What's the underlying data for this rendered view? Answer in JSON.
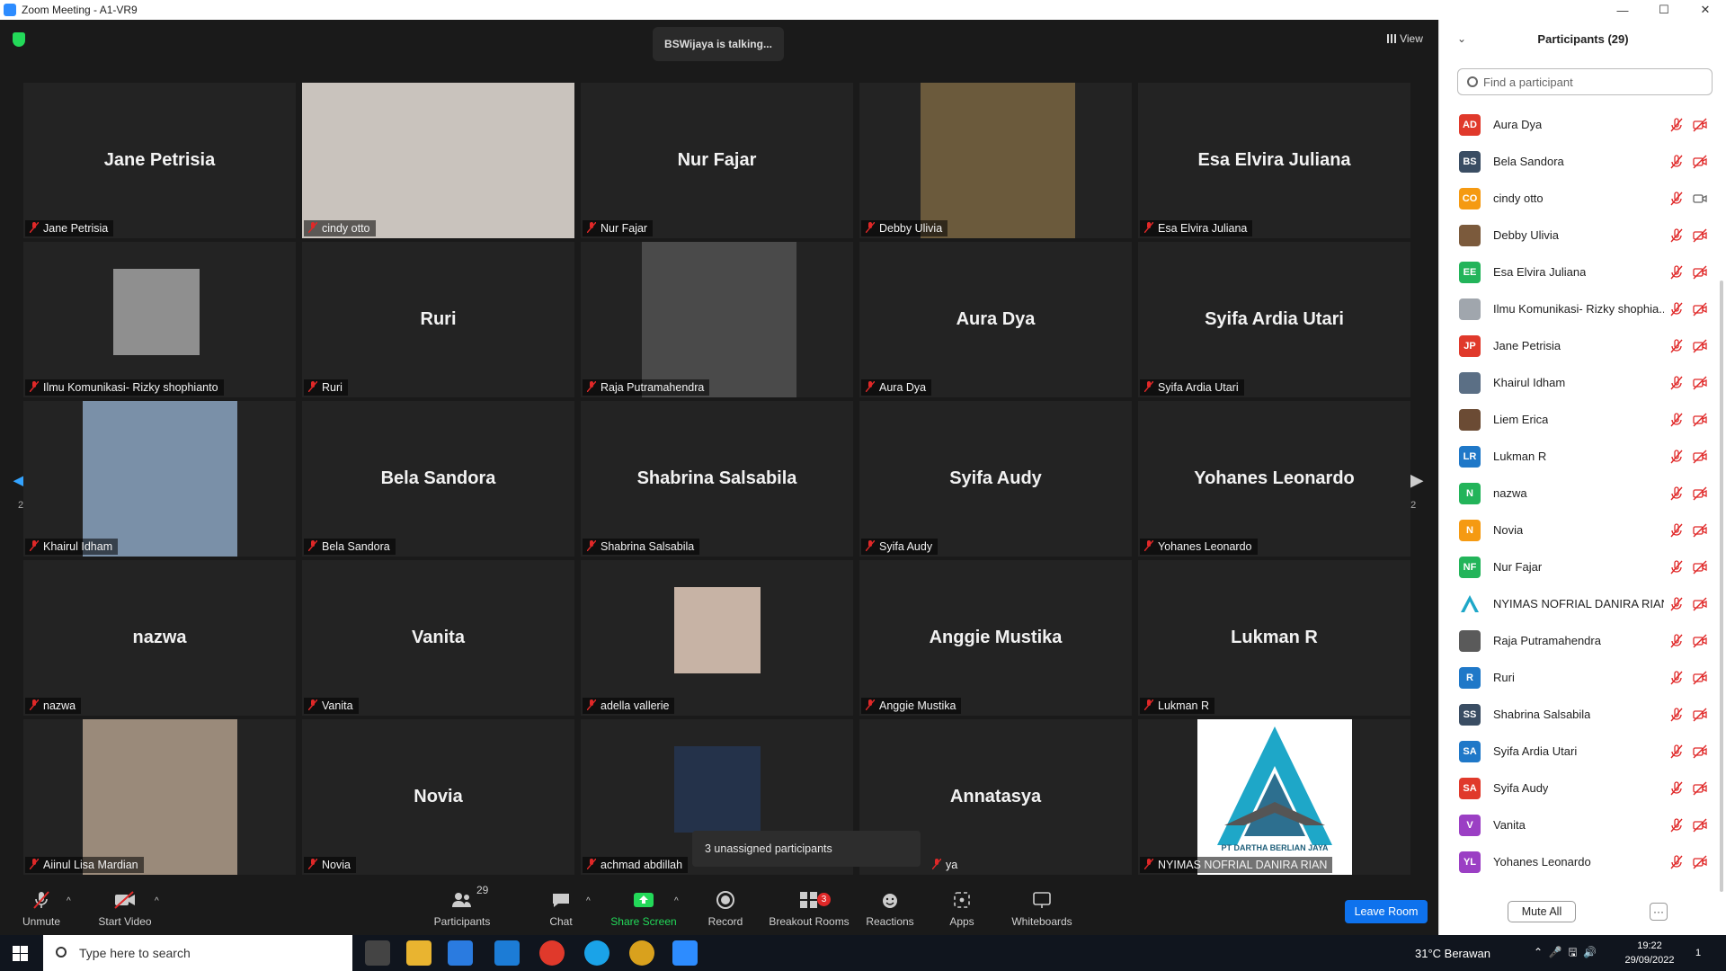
{
  "window": {
    "title": "Zoom Meeting - A1-VR9",
    "ctrl_min": "—",
    "ctrl_max": "☐",
    "ctrl_close": "✕"
  },
  "meeting": {
    "talking": "BSWijaya is talking...",
    "view_label": "View",
    "page_left": "2/2",
    "page_right": "2/2",
    "unassigned": "3 unassigned participants"
  },
  "tiles": [
    {
      "big": "Jane Petrisia",
      "label": "Jane Petrisia"
    },
    {
      "big": "",
      "label": "cindy otto",
      "photo": true
    },
    {
      "big": "Nur Fajar",
      "label": "Nur Fajar"
    },
    {
      "big": "",
      "label": "Debby Ulivia",
      "photo": true
    },
    {
      "big": "Esa Elvira Juliana",
      "label": "Esa Elvira Juliana"
    },
    {
      "big": "",
      "label": "Ilmu Komunikasi- Rizky shophianto",
      "photo": true
    },
    {
      "big": "Ruri",
      "label": "Ruri"
    },
    {
      "big": "",
      "label": "Raja Putramahendra",
      "photo": true
    },
    {
      "big": "Aura Dya",
      "label": "Aura Dya"
    },
    {
      "big": "Syifa Ardia Utari",
      "label": "Syifa Ardia Utari"
    },
    {
      "big": "",
      "label": "Khairul Idham",
      "photo": true
    },
    {
      "big": "Bela Sandora",
      "label": "Bela Sandora"
    },
    {
      "big": "Shabrina Salsabila",
      "label": "Shabrina Salsabila"
    },
    {
      "big": "Syifa Audy",
      "label": "Syifa Audy"
    },
    {
      "big": "Yohanes Leonardo",
      "label": "Yohanes Leonardo"
    },
    {
      "big": "nazwa",
      "label": "nazwa"
    },
    {
      "big": "Vanita",
      "label": "Vanita"
    },
    {
      "big": "",
      "label": "adella vallerie",
      "photo": true
    },
    {
      "big": "Anggie Mustika",
      "label": "Anggie Mustika"
    },
    {
      "big": "Lukman R",
      "label": "Lukman R"
    },
    {
      "big": "",
      "label": "Aiinul Lisa Mardian",
      "photo": true
    },
    {
      "big": "Novia",
      "label": "Novia"
    },
    {
      "big": "",
      "label": "achmad abdillah",
      "photo": true
    },
    {
      "big": "Annatasya",
      "label": "ya"
    },
    {
      "big": "",
      "label": "NYIMAS NOFRIAL DANIRA RIAN",
      "photo": true,
      "logo_text": "PT DARTHA BERLIAN JAYA"
    }
  ],
  "toolbar": {
    "unmute": "Unmute",
    "start_video": "Start Video",
    "participants": "Participants",
    "participants_count": "29",
    "chat": "Chat",
    "share": "Share Screen",
    "record": "Record",
    "breakout": "Breakout Rooms",
    "breakout_badge": "3",
    "reactions": "Reactions",
    "apps": "Apps",
    "whiteboards": "Whiteboards",
    "leave": "Leave Room",
    "caret": "^"
  },
  "panel": {
    "title": "Participants (29)",
    "collapse": "⌄",
    "search_placeholder": "Find a participant",
    "mute_all": "Mute All",
    "more": "···",
    "participants": [
      {
        "initials": "AD",
        "name": "Aura Dya",
        "color": "#e0392b",
        "video": "off"
      },
      {
        "initials": "BS",
        "name": "Bela Sandora",
        "color": "#3a4d63",
        "video": "off"
      },
      {
        "initials": "CO",
        "name": "cindy otto",
        "color": "#f59a12",
        "video": "on"
      },
      {
        "initials": "",
        "name": "Debby Ulivia",
        "color": "#7b5a3c",
        "video": "off"
      },
      {
        "initials": "EE",
        "name": "Esa Elvira Juliana",
        "color": "#23b45a",
        "video": "off"
      },
      {
        "initials": "",
        "name": "Ilmu Komunikasi- Rizky shophia...",
        "color": "#a0a6ad",
        "video": "off"
      },
      {
        "initials": "JP",
        "name": "Jane Petrisia",
        "color": "#e0392b",
        "video": "off"
      },
      {
        "initials": "",
        "name": "Khairul Idham",
        "color": "#5b6f85",
        "video": "off"
      },
      {
        "initials": "",
        "name": "Liem Erica",
        "color": "#6b4b34",
        "video": "off"
      },
      {
        "initials": "LR",
        "name": "Lukman R",
        "color": "#1f78c8",
        "video": "off"
      },
      {
        "initials": "N",
        "name": "nazwa",
        "color": "#23b45a",
        "video": "off"
      },
      {
        "initials": "N",
        "name": "Novia",
        "color": "#f59a12",
        "video": "off"
      },
      {
        "initials": "NF",
        "name": "Nur Fajar",
        "color": "#23b45a",
        "video": "off"
      },
      {
        "initials": "",
        "name": "NYIMAS NOFRIAL DANIRA RIAN",
        "color": "#ffffff",
        "video": "off"
      },
      {
        "initials": "",
        "name": "Raja Putramahendra",
        "color": "#5a5a5a",
        "video": "off"
      },
      {
        "initials": "R",
        "name": "Ruri",
        "color": "#1f78c8",
        "video": "off"
      },
      {
        "initials": "SS",
        "name": "Shabrina Salsabila",
        "color": "#3a4d63",
        "video": "off"
      },
      {
        "initials": "SA",
        "name": "Syifa Ardia Utari",
        "color": "#1f78c8",
        "video": "off"
      },
      {
        "initials": "SA",
        "name": "Syifa Audy",
        "color": "#e0392b",
        "video": "off"
      },
      {
        "initials": "V",
        "name": "Vanita",
        "color": "#9b3fc4",
        "video": "off"
      },
      {
        "initials": "YL",
        "name": "Yohanes Leonardo",
        "color": "#9b3fc4",
        "video": "off"
      }
    ]
  },
  "taskbar": {
    "search_placeholder": "Type here to search",
    "weather": "31°C  Berawan",
    "time": "19:22",
    "date": "29/09/2022",
    "notif": "1"
  },
  "colors": {
    "accent": "#0e72ed",
    "mic_off": "#e02828",
    "share": "#23d959"
  }
}
